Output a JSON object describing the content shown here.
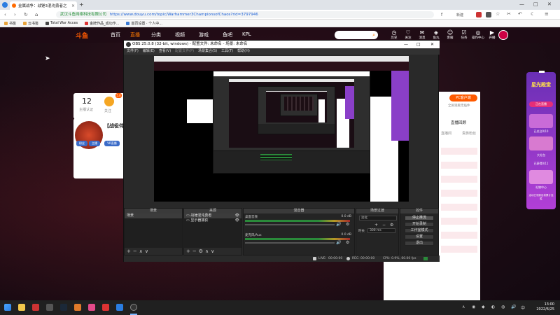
{
  "browser": {
    "tab_title": "金属战争：战锤3混沌勇者之",
    "tab_close": "×",
    "new_tab": "+",
    "url_secure_label": "武汉斗鱼网络科技有限公司",
    "url": "https://www.douyu.com/topic/Warhammer3ChampionsofChaos?rid=3797946",
    "controls": {
      "minimize": "—",
      "maximize": "□",
      "close": "✕"
    },
    "nav": {
      "back": "‹",
      "forward": "›",
      "reload": "↻",
      "home": "⌂"
    },
    "toolbar_right_label": "新建",
    "bookmarks": [
      "书签",
      "云书签",
      "Total War Acces",
      "金牌作品_成功作...",
      "首页设置 · 个人中..."
    ]
  },
  "douyu": {
    "logo": "斗鱼",
    "nav": [
      "首页",
      "直播",
      "分类",
      "视频",
      "游戏",
      "鱼吧",
      "KPL"
    ],
    "search_placeholder": "",
    "search_button_icon": "search-icon",
    "top_icons": [
      {
        "label": "历史",
        "glyph": "◷"
      },
      {
        "label": "关注",
        "glyph": "♡"
      },
      {
        "label": "消息",
        "glyph": "✉"
      },
      {
        "label": "鱼丸",
        "glyph": "◈"
      },
      {
        "label": "客服",
        "glyph": "☺"
      },
      {
        "label": "任务",
        "glyph": "☑"
      },
      {
        "label": "操作中心",
        "glyph": "◎"
      },
      {
        "label": "开播",
        "glyph": "▶"
      }
    ],
    "left_card": {
      "count": "12",
      "sub": "主播认证",
      "follow_label": "关注",
      "count_badge": "5.0"
    },
    "left_title": "【战役伟",
    "left_buttons": [
      "粉丝",
      "主播",
      "VR直播"
    ],
    "right_tabs": [
      "直播回顾",
      "直播间",
      "贵族粉丝"
    ],
    "right_pc": "PC客户端",
    "right_pc_sub": "全屏观看无插件",
    "sidebar_title": "星光殿堂",
    "sidebar_items": [
      "正在直播",
      "已关注0/10",
      "大礼包",
      "已获得0/11",
      "礼物中心",
      "活动已领到目前累计连胜"
    ]
  },
  "obs": {
    "title": "OBS 25.0.8 (32-bit, windows) - 配置文件: 未命名 - 场景: 未命名",
    "menu": [
      "文件(F)",
      "编辑(E)",
      "查看(V)",
      "配置文件(P)",
      "场景集合(S)",
      "工具(T)",
      "帮助(H)"
    ],
    "win_controls": {
      "minimize": "—",
      "maximize": "□",
      "close": "✕"
    },
    "docks": {
      "scenes": {
        "title": "场景",
        "items": [
          "场景"
        ]
      },
      "sources": {
        "title": "来源",
        "items": [
          "战锤混沌勇者",
          "显示器捕获"
        ]
      },
      "mixer": {
        "title": "混音器",
        "channels": [
          {
            "name": "桌面音频",
            "db": "0.0 dB"
          },
          {
            "name": "麦克风/Aux",
            "db": "0.0 dB"
          }
        ]
      },
      "transitions": {
        "title": "场景过渡",
        "type": "淡化",
        "duration_label": "时长",
        "duration": "300 ms"
      },
      "controls": {
        "title": "控件",
        "buttons": [
          "停止推流",
          "开始录制",
          "工作室模式",
          "设置",
          "退出"
        ]
      }
    },
    "status": {
      "live_label": "LIVE:",
      "live_time": "00:00:00",
      "rec_label": "REC:",
      "rec_time": "00:00:00",
      "cpu": "CPU: 0.9%, 60.00 fps"
    }
  },
  "taskbar": {
    "time": "13:00",
    "date": "2022/6/25"
  }
}
